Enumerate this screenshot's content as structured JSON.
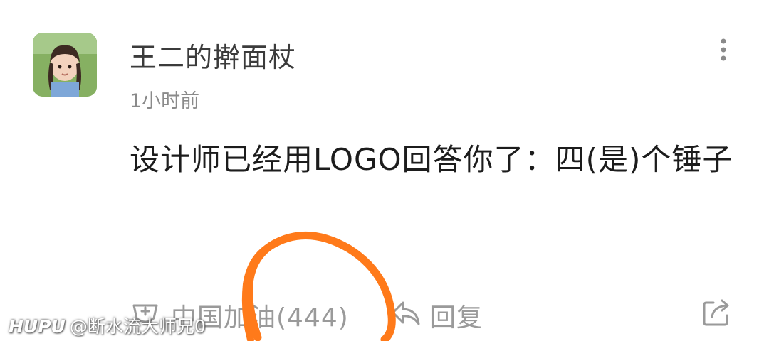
{
  "comment": {
    "username": "王二的擀面杖",
    "timestamp": "1小时前",
    "content": "设计师已经用LOGO回答你了：四(是)个锤子"
  },
  "actions": {
    "cheer_label": "中国加油(444)",
    "reply_label": "回复",
    "icons": [
      "cheer-icon",
      "reply-icon",
      "share-icon"
    ]
  },
  "annotation": {
    "color": "#ff7a1a",
    "shape": "hand-drawn circle"
  },
  "watermark": {
    "brand": "HUPU",
    "handle": "@断水流大师兄0"
  },
  "colors": {
    "username": "#3b3b3b",
    "timestamp": "#8a8a8a",
    "content": "#1c1c1c",
    "action": "#9a9a9a"
  }
}
